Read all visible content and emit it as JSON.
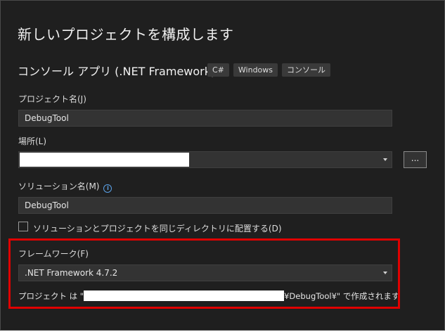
{
  "page": {
    "title": "新しいプロジェクトを構成します"
  },
  "template": {
    "name": "コンソール アプリ (.NET Framework)",
    "tags": [
      "C#",
      "Windows",
      "コンソール"
    ]
  },
  "project_name": {
    "label": "プロジェクト名(J)",
    "value": "DebugTool"
  },
  "location": {
    "label": "場所(L)",
    "browse_label": "..."
  },
  "solution_name": {
    "label": "ソリューション名(M)",
    "value": "DebugTool"
  },
  "same_dir": {
    "label": "ソリューションとプロジェクトを同じディレクトリに配置する(D)",
    "checked": false
  },
  "framework": {
    "label": "フレームワーク(F)",
    "value": ".NET Framework 4.7.2"
  },
  "result": {
    "prefix": "プロジェクト は \"",
    "suffix": "¥DebugTool¥\" で作成されます"
  },
  "colors": {
    "background": "#1f1f1f",
    "input_bg": "#333333",
    "highlight": "#e00000",
    "info_icon": "#5aa0e6"
  }
}
